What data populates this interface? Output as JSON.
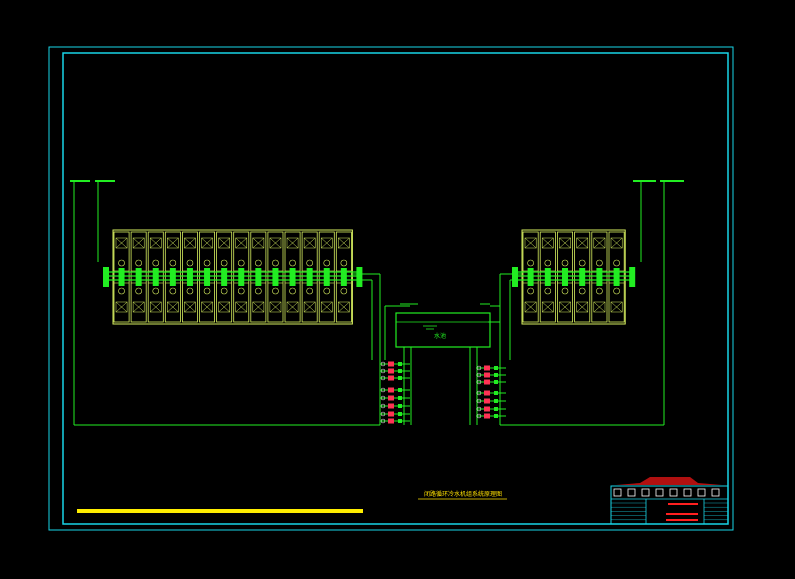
{
  "drawing": {
    "title": "闭路循环冷水机组系统原理图",
    "tank_label": "水池",
    "colors": {
      "background": "#000000",
      "border": "#19d6e8",
      "pipe": "#22ee22",
      "cell": "#d8f060",
      "valve": "#ff3355",
      "title_text": "#ffe000",
      "highlight_bar": "#ffee00",
      "title_block_red": "#b01010"
    },
    "left_array": {
      "columns": 14
    },
    "right_array": {
      "columns": 6
    }
  }
}
